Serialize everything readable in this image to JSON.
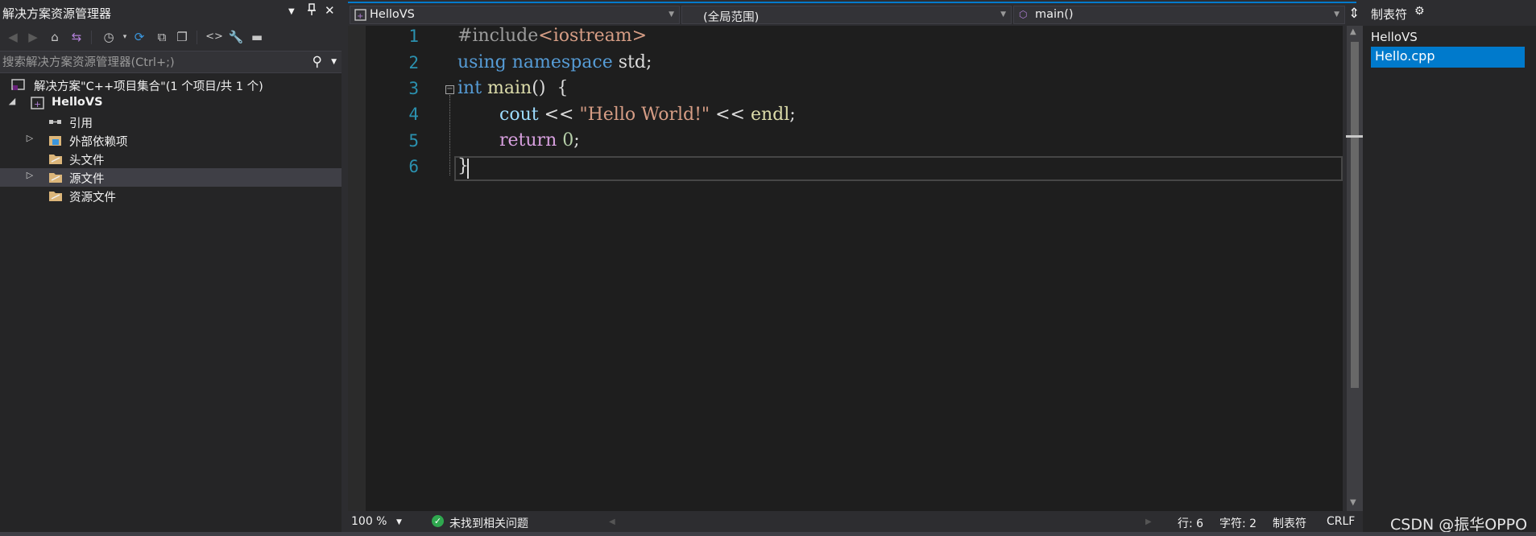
{
  "solution_explorer": {
    "title": "解决方案资源管理器",
    "controls": {
      "dropdown": "▾",
      "pin": "📌",
      "close": "✕"
    },
    "search_placeholder": "搜索解决方案资源管理器(Ctrl+;)",
    "tree": [
      {
        "label": "解决方案\"C++项目集合\"(1 个项目/共 1 个)",
        "icon": "solution-icon"
      },
      {
        "label": "HelloVS",
        "icon": "project-icon",
        "expander": "◢"
      },
      {
        "label": "引用",
        "icon": "references-icon"
      },
      {
        "label": "外部依赖项",
        "icon": "external-deps-icon",
        "expander": "▷"
      },
      {
        "label": "头文件",
        "icon": "folder-icon"
      },
      {
        "label": "源文件",
        "icon": "folder-icon",
        "expander": "▷"
      },
      {
        "label": "资源文件",
        "icon": "folder-icon"
      }
    ]
  },
  "editor": {
    "nav": {
      "project": "HelloVS",
      "scope": "(全局范围)",
      "member": "main()"
    },
    "line_numbers": [
      "1",
      "2",
      "3",
      "4",
      "5",
      "6"
    ],
    "current_line": 6,
    "code": {
      "l1_a": "#include",
      "l1_b": "<iostream>",
      "l2_a": "using",
      "l2_b": "namespace",
      "l2_c": "std;",
      "l3_a": "int",
      "l3_b": "main",
      "l3_c": "()  {",
      "l4_a": "cout",
      "l4_b": "<<",
      "l4_c": "\"Hello World!\"",
      "l4_d": "<<",
      "l4_e": "endl",
      "l4_f": ";",
      "l5_a": "return",
      "l5_b": "0",
      "l5_c": ";",
      "l6_a": "}"
    },
    "colors": {
      "keyword": "#569cd6",
      "string": "#d69d85",
      "function": "#dcdcaa",
      "line_number": "#2b91af",
      "accent": "#007acc"
    }
  },
  "statusbar": {
    "zoom": "100 %",
    "issues": "未找到相关问题",
    "line": "行: 6",
    "col": "字符: 2",
    "indent": "制表符",
    "eol": "CRLF"
  },
  "right_panel": {
    "title": "制表符",
    "project": "HelloVS",
    "file": "Hello.cpp"
  },
  "watermark": "CSDN @振华OPPO"
}
